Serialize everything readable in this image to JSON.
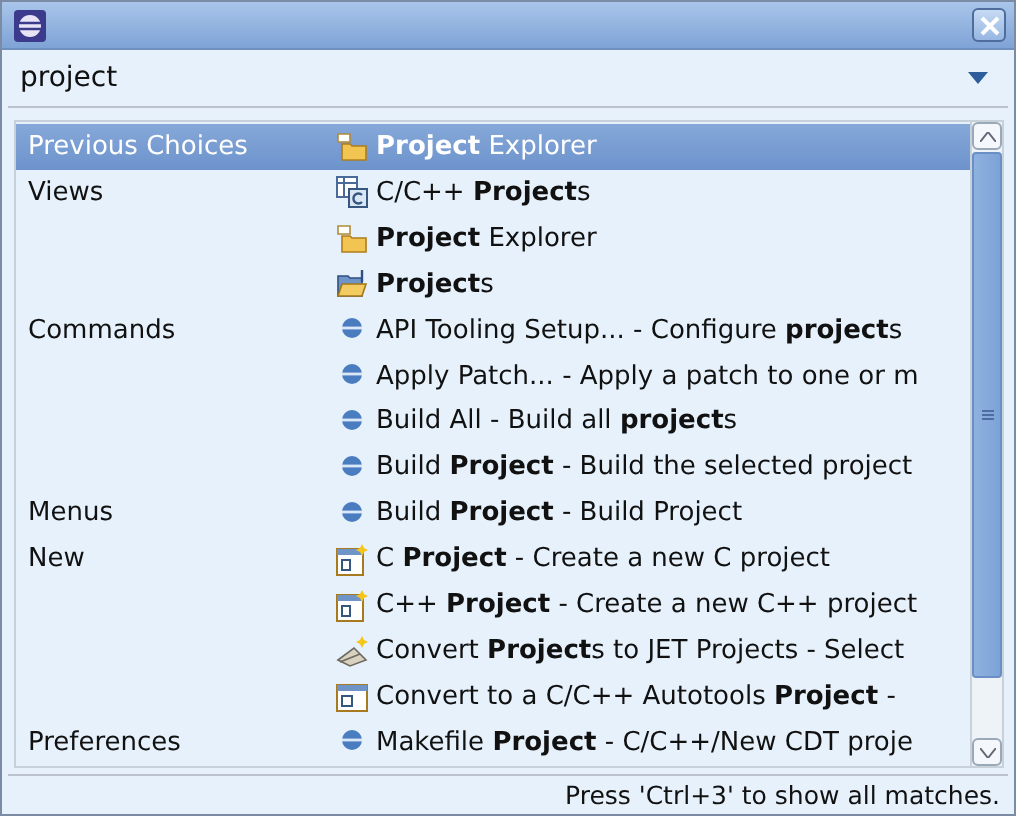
{
  "search": {
    "value": "project"
  },
  "rows": [
    {
      "category": "Previous Choices",
      "kind": "view-folder",
      "text": "**Project** Explorer",
      "selected": true
    },
    {
      "category": "Views",
      "kind": "cpp-view",
      "text": "C/C++ **Project**s",
      "selected": false
    },
    {
      "kind": "view-folder",
      "text": "**Project** Explorer",
      "selected": false
    },
    {
      "kind": "open-folder",
      "text": "**Project**s",
      "selected": false
    },
    {
      "category": "Commands",
      "kind": "command",
      "text": "API Tooling Setup... - Configure **project**s",
      "selected": false
    },
    {
      "kind": "command",
      "text": "Apply Patch... - Apply a patch to one or m",
      "selected": false
    },
    {
      "kind": "command",
      "text": "Build All - Build all **project**s",
      "selected": false
    },
    {
      "kind": "command",
      "text": "Build **Project** - Build the selected project",
      "selected": false
    },
    {
      "category": "Menus",
      "kind": "command",
      "text": "Build **Project** - Build Project",
      "selected": false
    },
    {
      "category": "New",
      "kind": "wizard",
      "text": "C **Project** - Create a new C project",
      "selected": false
    },
    {
      "kind": "wizard",
      "text": "C++ **Project** - Create a new C++ project",
      "selected": false
    },
    {
      "kind": "convert",
      "text": "Convert **Project**s to JET Projects - Select",
      "selected": false
    },
    {
      "kind": "editor",
      "text": "Convert to a C/C++ Autotools **Project** -",
      "selected": false
    },
    {
      "category": "Preferences",
      "kind": "command",
      "text": "Makefile **Project** - C/C++/New CDT proje",
      "selected": false
    }
  ],
  "status_bar": "Press 'Ctrl+3' to show all matches."
}
